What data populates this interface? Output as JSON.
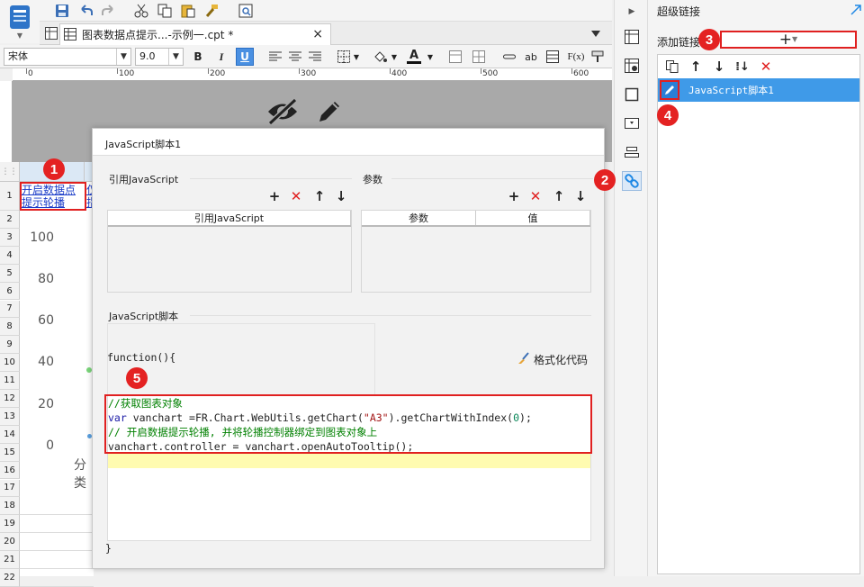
{
  "toolbar": {
    "icons": [
      "save-icon",
      "undo-icon",
      "redo-icon",
      "cut-icon",
      "copy-icon",
      "paste-icon",
      "format-painter-icon",
      "preview-icon"
    ]
  },
  "tab": {
    "title": "图表数据点提示...-示例一.cpt *",
    "close": "×"
  },
  "format_bar": {
    "font_name": "宋体",
    "font_size": "9.0",
    "bold": "B",
    "italic": "I",
    "underline": "U",
    "ab_label": "ab",
    "fx_label": "F(x)"
  },
  "ruler": {
    "marks": [
      "0",
      "100",
      "200",
      "300",
      "400",
      "500",
      "600"
    ]
  },
  "sheet": {
    "row_numbers": [
      "1",
      "2",
      "3",
      "4",
      "5",
      "6",
      "7",
      "8",
      "9",
      "10",
      "11",
      "12",
      "13",
      "14",
      "15",
      "16",
      "17",
      "18",
      "19",
      "20",
      "21",
      "22"
    ],
    "cell_a1_line1": "开启数据点",
    "cell_a1_line2": "提示轮播",
    "cell_b1_line1": "仅",
    "cell_b1_line2": "指",
    "y_axis": [
      "100",
      "80",
      "60",
      "40",
      "20",
      "0"
    ],
    "x_label_partial": "分类"
  },
  "dialog": {
    "title": "JavaScript脚本1",
    "ref_js_section": "引用JavaScript",
    "ref_js_col": "引用JavaScript",
    "params_section": "参数",
    "params_col1": "参数",
    "params_col2": "值",
    "script_section": "JavaScript脚本",
    "format_code": "格式化代码",
    "func_open": "function(){",
    "func_close": "}",
    "code": {
      "line1": "//获取图表对象",
      "line2_kw": "var",
      "line2_rest": " vanchart =FR.Chart.WebUtils.getChart(",
      "line2_str": "\"A3\"",
      "line2_mid": ").getChartWithIndex(",
      "line2_num": "0",
      "line2_end": ");",
      "line3": "// 开启数据提示轮播, 并将轮播控制器绑定到图表对象上",
      "line4": "vanchart.controller = vanchart.openAutoTooltip();"
    }
  },
  "right_panel": {
    "title": "超级链接",
    "add_label": "添加链接",
    "add_button": "+",
    "selected_item": "JavaScript脚本1"
  },
  "badges": [
    "1",
    "2",
    "3",
    "4",
    "5"
  ],
  "colors": {
    "accent": "#1e88e5",
    "selection": "#3f9ae8",
    "annotation": "#e02020",
    "keyword": "#1a1aa6",
    "comment": "#008000",
    "string": "#a31515"
  }
}
